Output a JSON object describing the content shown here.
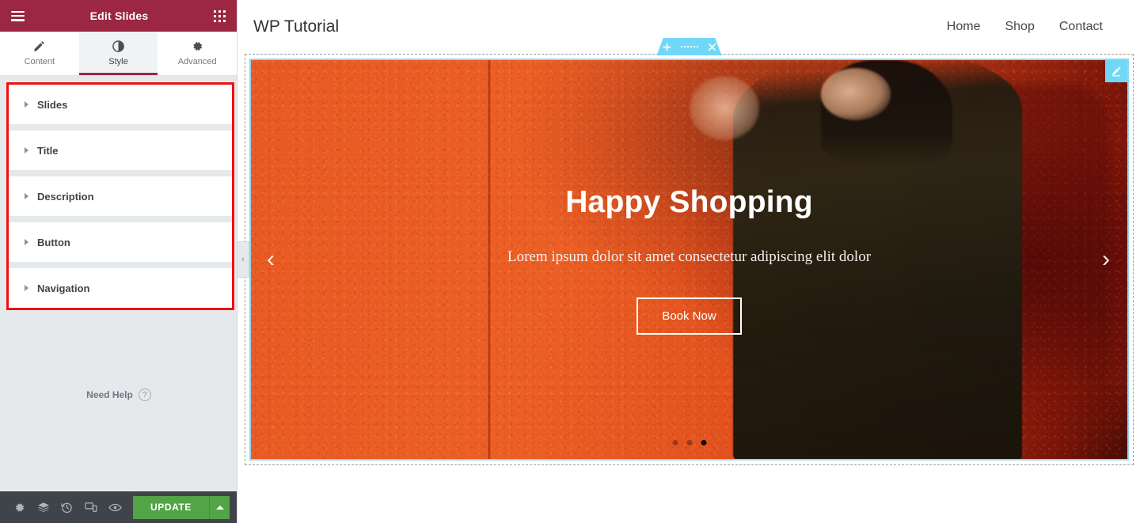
{
  "panel": {
    "header": {
      "title": "Edit Slides",
      "menu_icon": "hamburger-icon",
      "apps_icon": "grid-apps-icon"
    },
    "tabs": [
      {
        "label": "Content",
        "icon": "pencil-icon",
        "active": false
      },
      {
        "label": "Style",
        "icon": "half-circle-contrast-icon",
        "active": true
      },
      {
        "label": "Advanced",
        "icon": "gear-icon",
        "active": false
      }
    ],
    "accordion": [
      {
        "label": "Slides"
      },
      {
        "label": "Title"
      },
      {
        "label": "Description"
      },
      {
        "label": "Button"
      },
      {
        "label": "Navigation"
      }
    ],
    "highlight_color": "#f01010",
    "need_help": {
      "label": "Need Help",
      "icon": "question-circle-icon"
    },
    "footer": {
      "icons": [
        "settings-gear-icon",
        "layers-navigator-icon",
        "history-clock-icon",
        "responsive-mode-icon",
        "preview-eye-icon"
      ],
      "update_label": "UPDATE",
      "update_color": "#52a447",
      "caret_icon": "caret-up-icon"
    },
    "collapse_handle_icon": "chevron-left-icon",
    "header_color": "#9b2743"
  },
  "preview": {
    "site_title": "WP Tutorial",
    "nav": [
      {
        "label": "Home"
      },
      {
        "label": "Shop"
      },
      {
        "label": "Contact"
      }
    ],
    "section_toolbar": {
      "add_icon": "plus-icon",
      "drag_icon": "drag-handle-dots-icon",
      "close_icon": "close-x-icon",
      "color": "#71d7f7"
    },
    "widget_edit_icon": "pencil-edit-icon",
    "slide": {
      "title": "Happy Shopping",
      "description": "Lorem ipsum dolor sit amet consectetur adipiscing elit dolor",
      "button_label": "Book Now",
      "prev_icon": "chevron-left-icon",
      "next_icon": "chevron-right-icon",
      "dots": [
        {
          "active": false
        },
        {
          "active": false
        },
        {
          "active": true
        }
      ]
    }
  }
}
